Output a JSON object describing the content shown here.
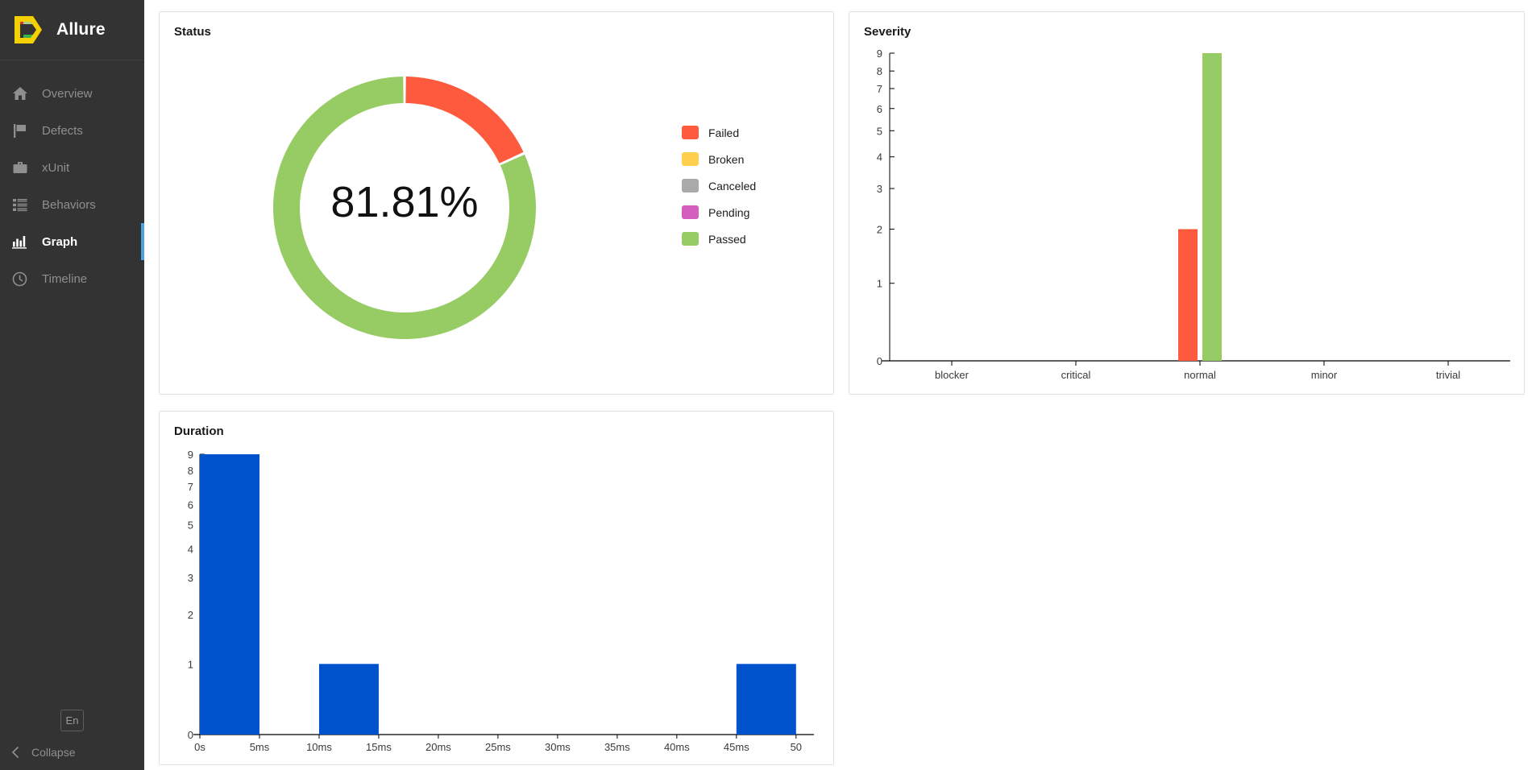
{
  "brand": {
    "name": "Allure",
    "logo_icon": "allure-logo-icon"
  },
  "sidebar": {
    "items": [
      {
        "label": "Overview",
        "icon": "home-icon",
        "active": false
      },
      {
        "label": "Defects",
        "icon": "flag-icon",
        "active": false
      },
      {
        "label": "xUnit",
        "icon": "briefcase-icon",
        "active": false
      },
      {
        "label": "Behaviors",
        "icon": "list-icon",
        "active": false
      },
      {
        "label": "Graph",
        "icon": "bar-chart-icon",
        "active": true
      },
      {
        "label": "Timeline",
        "icon": "clock-icon",
        "active": false
      }
    ],
    "language_button": "En",
    "collapse_label": "Collapse",
    "collapse_icon": "chevron-left-icon"
  },
  "cards": {
    "status": {
      "title": "Status"
    },
    "severity": {
      "title": "Severity"
    },
    "duration": {
      "title": "Duration"
    }
  },
  "colors": {
    "failed": "#fd5a3e",
    "broken": "#ffd050",
    "canceled": "#aaaaaa",
    "pending": "#d35ebe",
    "passed": "#97cc64",
    "duration_bar": "#0052cc",
    "accent": "#4aa3e0",
    "sidebar_bg": "#333333",
    "card_border": "#e0e0e0"
  },
  "chart_data": [
    {
      "type": "pie",
      "name": "status-donut",
      "title": "Status",
      "center_label": "81.81%",
      "legend_position": "right",
      "labels": [
        "Failed",
        "Broken",
        "Canceled",
        "Pending",
        "Passed"
      ],
      "values": [
        2,
        0,
        0,
        0,
        9
      ],
      "percents": [
        18.19,
        0,
        0,
        0,
        81.81
      ],
      "colors": [
        "#fd5a3e",
        "#ffd050",
        "#aaaaaa",
        "#d35ebe",
        "#97cc64"
      ],
      "donut": true,
      "start_angle_deg": 0,
      "slice_order": [
        "Failed",
        "Passed"
      ]
    },
    {
      "type": "bar",
      "name": "severity-bars",
      "title": "Severity",
      "xlabel": "",
      "ylabel": "",
      "categories": [
        "blocker",
        "critical",
        "normal",
        "minor",
        "trivial"
      ],
      "yticks": [
        0,
        1,
        2,
        3,
        4,
        5,
        6,
        7,
        8,
        9
      ],
      "ylim": [
        0,
        9
      ],
      "grid": false,
      "series": [
        {
          "name": "Failed",
          "color": "#fd5a3e",
          "values": [
            0,
            0,
            2,
            0,
            0
          ]
        },
        {
          "name": "Passed",
          "color": "#97cc64",
          "values": [
            0,
            0,
            9,
            0,
            0
          ]
        }
      ]
    },
    {
      "type": "bar",
      "name": "duration-histogram",
      "title": "Duration",
      "xlabel": "",
      "ylabel": "",
      "xticks": [
        "0s",
        "5ms",
        "10ms",
        "15ms",
        "20ms",
        "25ms",
        "30ms",
        "35ms",
        "40ms",
        "45ms",
        "50"
      ],
      "yticks": [
        0,
        1,
        2,
        3,
        4,
        5,
        6,
        7,
        8,
        9
      ],
      "ylim": [
        0,
        9
      ],
      "grid": false,
      "color": "#0052cc",
      "bins": [
        {
          "from": "0s",
          "to": "5ms",
          "value": 9
        },
        {
          "from": "5ms",
          "to": "10ms",
          "value": 0
        },
        {
          "from": "10ms",
          "to": "15ms",
          "value": 1
        },
        {
          "from": "15ms",
          "to": "20ms",
          "value": 0
        },
        {
          "from": "20ms",
          "to": "25ms",
          "value": 0
        },
        {
          "from": "25ms",
          "to": "30ms",
          "value": 0
        },
        {
          "from": "30ms",
          "to": "35ms",
          "value": 0
        },
        {
          "from": "35ms",
          "to": "40ms",
          "value": 0
        },
        {
          "from": "40ms",
          "to": "45ms",
          "value": 0
        },
        {
          "from": "45ms",
          "to": "50ms",
          "value": 1
        }
      ]
    }
  ]
}
